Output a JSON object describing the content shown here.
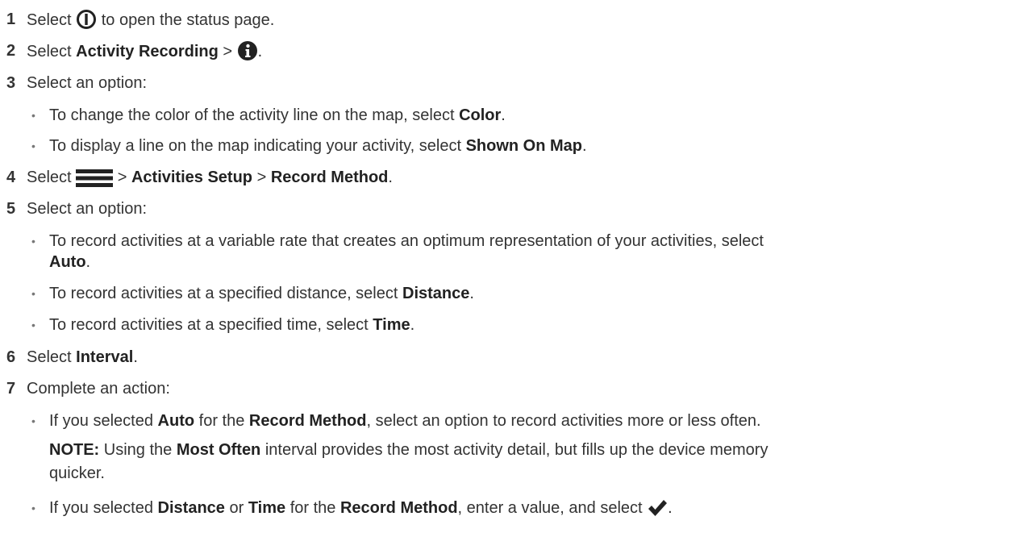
{
  "steps": [
    {
      "num": "1",
      "pre": "Select",
      "post": "to open the status page.",
      "icon": "power-icon"
    },
    {
      "num": "2",
      "pre": "Select",
      "b1": "Activity Recording",
      "sep": ">",
      "post": ".",
      "icon": "info-icon"
    },
    {
      "num": "3",
      "text": "Select an option:"
    },
    {
      "num": "4",
      "pre": "Select",
      "sep1": ">",
      "b1": "Activities Setup",
      "sep2": ">",
      "b2": "Record Method",
      "post": ".",
      "icon": "menu-icon"
    },
    {
      "num": "5",
      "text": "Select an option:"
    },
    {
      "num": "6",
      "pre": "Select",
      "b1": "Interval",
      "post": "."
    },
    {
      "num": "7",
      "text": "Complete an action:"
    }
  ],
  "bullets3": [
    {
      "pre": "To change the color of the activity line on the map, select",
      "b": "Color",
      "post": "."
    },
    {
      "pre": "To display a line on the map indicating your activity, select",
      "b": "Shown On Map",
      "post": "."
    }
  ],
  "bullets5": [
    {
      "pre": "To record activities at a variable rate that creates an optimum representation of your activities, select",
      "b": "Auto",
      "post": "."
    },
    {
      "pre": "To record activities at a specified distance, select",
      "b": "Distance",
      "post": "."
    },
    {
      "pre": "To record activities at a specified time, select",
      "b": "Time",
      "post": "."
    }
  ],
  "bullets7": [
    {
      "pre": "If you selected",
      "b1": "Auto",
      "mid1": "for the",
      "b2": "Record Method",
      "post": ", select an option to record activities more or less often."
    },
    {
      "pre": "If you selected",
      "b1": "Distance",
      "mid1": "or",
      "b2": "Time",
      "mid2": "for the",
      "b3": "Record Method",
      "post": ", enter a value, and select",
      "end": ".",
      "icon": "checkmark-icon"
    }
  ],
  "note": {
    "label": "NOTE:",
    "pre": "Using the",
    "b": "Most Often",
    "post": "interval provides the most activity detail, but fills up the device memory",
    "line2": "quicker."
  }
}
